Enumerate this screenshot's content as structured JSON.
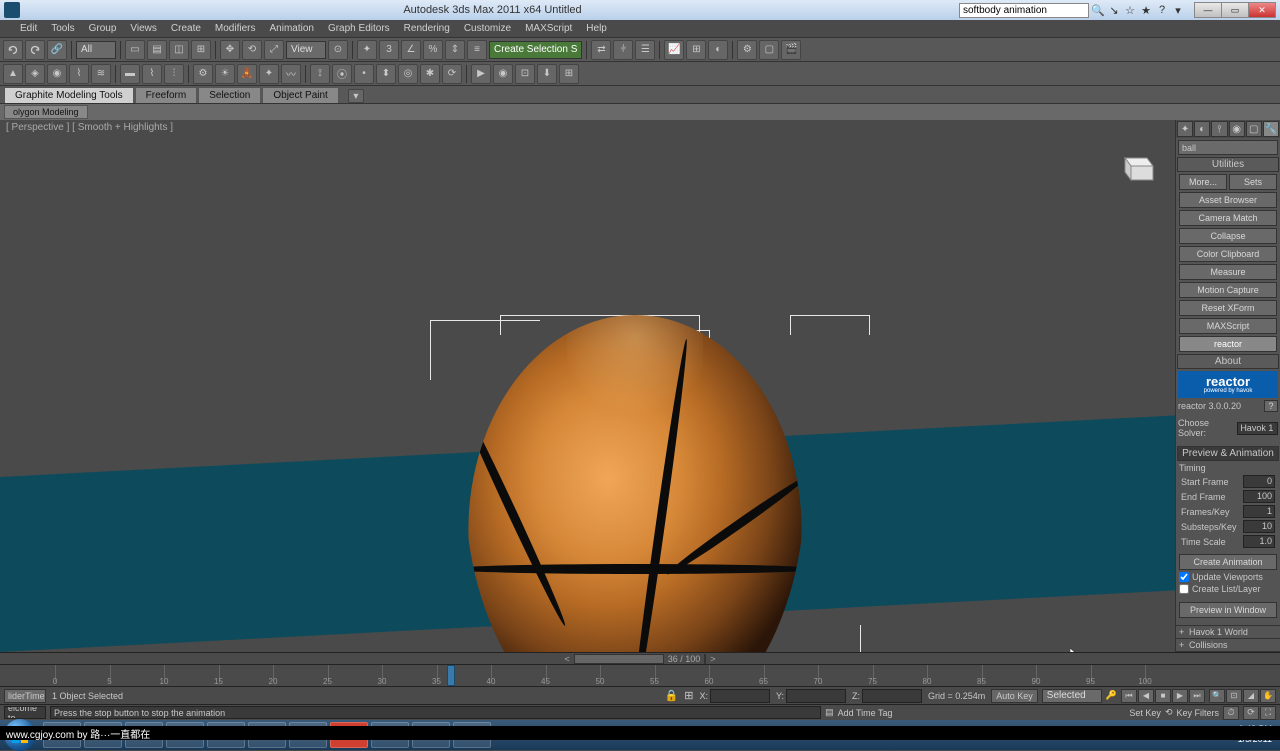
{
  "titlebar": {
    "app_title": "Autodesk 3ds Max 2011 x64     Untitled",
    "search_value": "softbody animation"
  },
  "menu": {
    "items": [
      "Edit",
      "Tools",
      "Group",
      "Views",
      "Create",
      "Modifiers",
      "Animation",
      "Graph Editors",
      "Rendering",
      "Customize",
      "MAXScript",
      "Help"
    ]
  },
  "toolbar": {
    "layer_sel": "All",
    "view_sel": "View",
    "create_sel": "Create Selection S"
  },
  "ribbon": {
    "tabs": [
      "Graphite Modeling Tools",
      "Freeform",
      "Selection",
      "Object Paint"
    ],
    "subtab": "olygon Modeling"
  },
  "viewport": {
    "label": "[ Perspective ] [ Smooth + Highlights ]"
  },
  "cmdpanel": {
    "object_name": "ball",
    "utilities_hdr": "Utilities",
    "more_btn": "More...",
    "sets_btn": "Sets",
    "util_items": [
      "Asset Browser",
      "Camera Match",
      "Collapse",
      "Color Clipboard",
      "Measure",
      "Motion Capture",
      "Reset XForm",
      "MAXScript",
      "reactor"
    ],
    "about_hdr": "About",
    "reactor_brand": "reactor",
    "reactor_sub": "powered by havok",
    "reactor_ver": "reactor 3.0.0.20",
    "solver_label": "Choose Solver:",
    "solver_value": "Havok 1",
    "preview_hdr": "Preview & Animation",
    "timing_label": "Timing",
    "start_frame_l": "Start Frame",
    "start_frame_v": "0",
    "end_frame_l": "End Frame",
    "end_frame_v": "100",
    "frames_key_l": "Frames/Key",
    "frames_key_v": "1",
    "substeps_l": "Substeps/Key",
    "substeps_v": "10",
    "time_scale_l": "Time Scale",
    "time_scale_v": "1.0",
    "create_anim_btn": "Create Animation",
    "update_vp": "Update Viewports",
    "create_list": "Create List/Layer",
    "preview_btn": "Preview in Window",
    "footer1": "Havok 1 World",
    "footer2": "Collisions"
  },
  "timeline": {
    "frame_display": "36 / 100",
    "ticks": [
      "0",
      "5",
      "10",
      "15",
      "20",
      "25",
      "30",
      "35",
      "40",
      "45",
      "50",
      "55",
      "60",
      "65",
      "70",
      "75",
      "80",
      "85",
      "90",
      "95",
      "100"
    ],
    "playhead_pct": 36
  },
  "statusbar": {
    "box1": "liderTime",
    "box2": "elcome to",
    "selection": "1 Object Selected",
    "prompt": "Press the stop button to stop the animation",
    "x_label": "X:",
    "y_label": "Y:",
    "z_label": "Z:",
    "grid": "Grid = 0.254m",
    "add_time_tag": "Add Time Tag",
    "auto_key": "Auto Key",
    "set_key": "Set Key",
    "selected": "Selected",
    "key_filters": "Key Filters"
  },
  "taskbar": {
    "time": "6:48 PM",
    "date": "1/5/2011"
  },
  "watermark": {
    "text": "www.cgjoy.com by 路···一直都在"
  }
}
